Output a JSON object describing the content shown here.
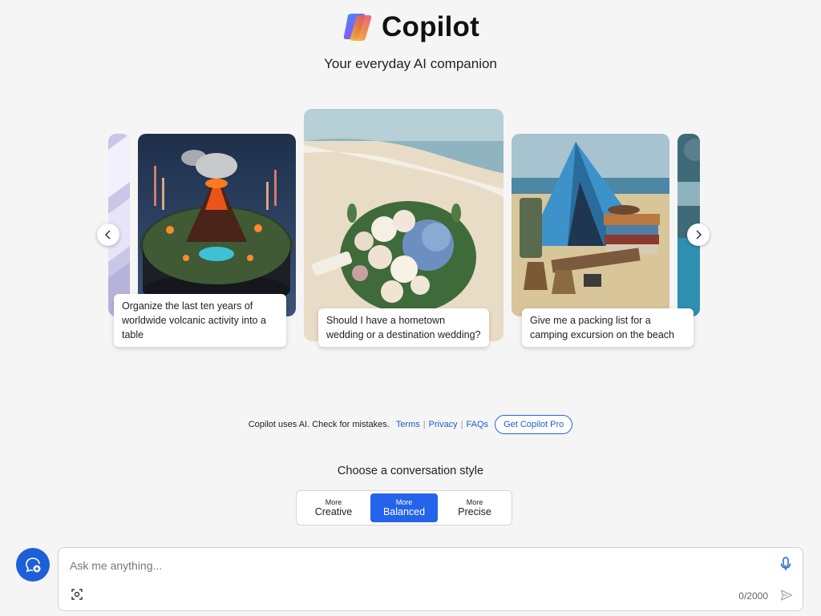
{
  "header": {
    "title": "Copilot",
    "tagline": "Your everyday AI companion"
  },
  "carousel": {
    "cards": [
      {
        "caption": "Organize the last ten years of worldwide volcanic activity into a table",
        "image": "volcano-infographic"
      },
      {
        "caption": "Should I have a hometown wedding or a destination wedding?",
        "image": "wedding-bouquet-on-beach"
      },
      {
        "caption": "Give me a packing list for a camping excursion on the beach",
        "image": "beach-camping-tent"
      }
    ],
    "prev_icon": "chevron-left-icon",
    "next_icon": "chevron-right-icon"
  },
  "footer": {
    "disclaimer": "Copilot uses AI. Check for mistakes.",
    "links": [
      "Terms",
      "Privacy",
      "FAQs"
    ],
    "pro_button": "Get Copilot Pro"
  },
  "conversation_style": {
    "label": "Choose a conversation style",
    "options": [
      {
        "small": "More",
        "big": "Creative",
        "active": false
      },
      {
        "small": "More",
        "big": "Balanced",
        "active": true
      },
      {
        "small": "More",
        "big": "Precise",
        "active": false
      }
    ]
  },
  "input": {
    "placeholder": "Ask me anything...",
    "counter": "0/2000"
  },
  "colors": {
    "accent": "#2563eb",
    "background": "#f5f5f5",
    "link": "#1a5fcc"
  }
}
